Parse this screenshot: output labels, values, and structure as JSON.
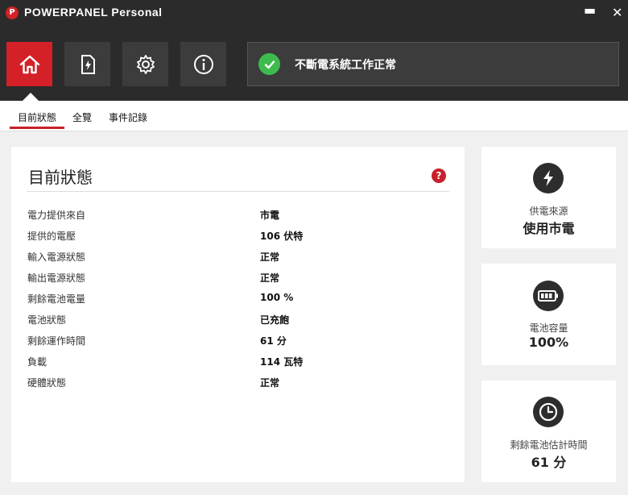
{
  "app": {
    "logo_glyph": "P",
    "title": "POWERPANEL Personal"
  },
  "window": {
    "minimize_glyph": "▬",
    "close_glyph": "✕"
  },
  "toolbar": {
    "buttons": [
      {
        "icon": "home-icon",
        "active": true
      },
      {
        "icon": "power-file-icon",
        "active": false
      },
      {
        "icon": "gear-icon",
        "active": false
      },
      {
        "icon": "info-icon",
        "active": false
      }
    ]
  },
  "status": {
    "text": "不斷電系統工作正常",
    "color": "#3dbb4d"
  },
  "tabs": [
    {
      "label": "目前狀態",
      "active": true
    },
    {
      "label": "全覽",
      "active": false
    },
    {
      "label": "事件記錄",
      "active": false
    }
  ],
  "main": {
    "title": "目前狀態",
    "help_glyph": "?",
    "rows": [
      {
        "label": "電力提供來自",
        "value": "市電"
      },
      {
        "label": "提供的電壓",
        "value": "106 伏特"
      },
      {
        "label": "輸入電源狀態",
        "value": "正常"
      },
      {
        "label": "輸出電源狀態",
        "value": "正常"
      },
      {
        "label": "剩餘電池電量",
        "value": "100 %"
      },
      {
        "label": "電池狀態",
        "value": "已充飽"
      },
      {
        "label": "剩餘運作時間",
        "value": "61 分"
      },
      {
        "label": "負載",
        "value": "114 瓦特"
      },
      {
        "label": "硬體狀態",
        "value": "正常"
      }
    ]
  },
  "side": {
    "power_source": {
      "icon": "lightning-icon",
      "label": "供電來源",
      "value": "使用市電"
    },
    "battery": {
      "icon": "battery-icon",
      "label": "電池容量",
      "value": "100%"
    },
    "runtime": {
      "icon": "clock-icon",
      "label": "剩餘電池估計時間",
      "value": "61 分"
    }
  },
  "colors": {
    "accent": "#d42027",
    "titlebar": "#2b2b2b",
    "background": "#f0f0f0"
  }
}
